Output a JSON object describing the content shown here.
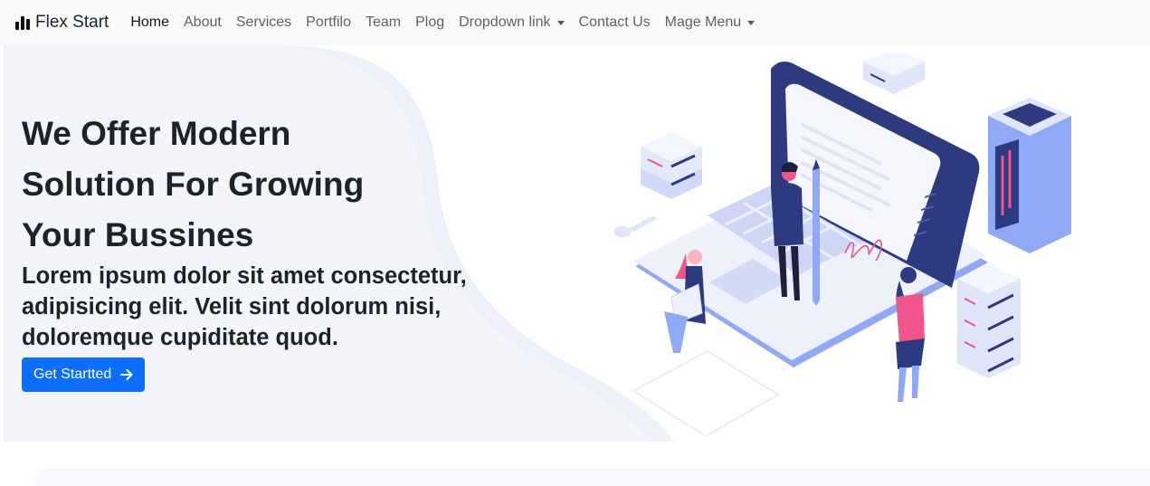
{
  "brand": {
    "name": "Flex Start",
    "icon": "bar-chart-icon"
  },
  "nav": {
    "items": [
      {
        "label": "Home",
        "active": true
      },
      {
        "label": "About"
      },
      {
        "label": "Services"
      },
      {
        "label": "Portfilo"
      },
      {
        "label": "Team"
      },
      {
        "label": "Plog"
      },
      {
        "label": "Dropdown link",
        "dropdown": true
      },
      {
        "label": "Contact Us"
      },
      {
        "label": "Mage Menu",
        "dropdown": true
      }
    ]
  },
  "hero": {
    "title_lines": [
      "We Offer Modern",
      "Solution For Growing",
      "Your Bussines"
    ],
    "subtitle_lines": [
      "Lorem ipsum dolor sit amet consectetur,",
      "adipisicing elit. Velit sint dolorum nisi,",
      "doloremque cupiditate quod."
    ],
    "cta_label": "Get Startted",
    "cta_icon": "arrow-right-icon",
    "illustration": "laptop-team-illustration"
  },
  "colors": {
    "primary": "#0d6efd",
    "navbar_bg": "#f8f9fa",
    "hero_bg": "#f3f5fb",
    "illustration_blue": "#2e3a80",
    "illustration_light": "#90a9f7",
    "accent_pink": "#f0568c"
  }
}
